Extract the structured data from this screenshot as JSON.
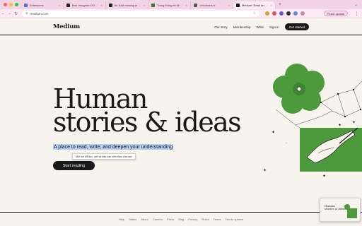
{
  "browser": {
    "tabs": [
      {
        "label": "Extensions",
        "color": "#4a6fd8",
        "active": false
      },
      {
        "label": "feat: Integrate DOMPurify for",
        "color": "#222222",
        "active": false
      },
      {
        "label": "fix: Add missing meta charset",
        "color": "#222222",
        "active": false
      },
      {
        "label": "Trang thông tin liên lạc của hải",
        "color": "#2e7d32",
        "active": false
      },
      {
        "label": "<rich/trans-fr",
        "color": "#555555",
        "active": false
      },
      {
        "label": "Medium: Read and write stories",
        "color": "#111111",
        "active": true
      }
    ],
    "new_tab": "+",
    "url": "medium.com",
    "finish_update": "Finish update"
  },
  "header": {
    "logo": "Medium",
    "nav": [
      "Our story",
      "Membership",
      "Write",
      "Sign in"
    ],
    "cta": "Get started"
  },
  "hero": {
    "title_line1": "Human",
    "title_line2": "stories & ideas",
    "tagline": "A place to read, write, and deepen your understanding",
    "tooltip": "Một nơi để đọc, viết và đào sâu kiến thức của bạn",
    "button": "Start reading"
  },
  "footer": {
    "links": [
      "Help",
      "Status",
      "About",
      "Careers",
      "Press",
      "Blog",
      "Privacy",
      "Rules",
      "Terms",
      "Text to speech"
    ]
  },
  "pip": {
    "line1": "Human",
    "line2": "stories & ideas"
  },
  "colors": {
    "background": "#f7f4ed",
    "text": "#191919",
    "accent_green": "#4c9a3c",
    "tab_bar": "#f2d4e5",
    "selection": "#b4cff3"
  }
}
